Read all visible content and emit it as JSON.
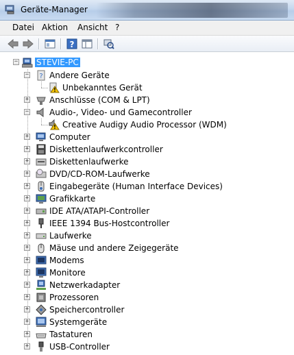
{
  "window": {
    "title": "Geräte-Manager"
  },
  "menu": [
    {
      "key": "datei",
      "label": "Datei"
    },
    {
      "key": "aktion",
      "label": "Aktion"
    },
    {
      "key": "ansicht",
      "label": "Ansicht"
    },
    {
      "key": "help",
      "label": "?"
    }
  ],
  "toolbar": {
    "buttons": [
      "back-icon",
      "forward-icon",
      "properties-view-icon",
      "help-icon",
      "console-tree-icon",
      "scan-hardware-icon"
    ]
  },
  "tree": {
    "root": "STEVIE-PC",
    "andere": "Andere Geräte",
    "unbekannt": "Unbekanntes Gerät",
    "anschluesse": "Anschlüsse (COM & LPT)",
    "audio": "Audio-, Video- und Gamecontroller",
    "creative": "Creative Audigy Audio Processor (WDM)",
    "computer": "Computer",
    "diskctrl": "Diskettenlaufwerkcontroller",
    "disk": "Diskettenlaufwerke",
    "dvd": "DVD/CD-ROM-Laufwerke",
    "eingabe": "Eingabegeräte (Human Interface Devices)",
    "grafik": "Grafikkarte",
    "ide": "IDE ATA/ATAPI-Controller",
    "ieee": "IEEE 1394 Bus-Hostcontroller",
    "laufwerke": "Laufwerke",
    "maeuse": "Mäuse und andere Zeigegeräte",
    "modems": "Modems",
    "monitore": "Monitore",
    "netzwerk": "Netzwerkadapter",
    "prozessoren": "Prozessoren",
    "speicher": "Speichercontroller",
    "system": "Systemgeräte",
    "tastaturen": "Tastaturen",
    "usb": "USB-Controller"
  },
  "colors": {
    "selection": "#3399ff",
    "warning": "#f5c400"
  }
}
